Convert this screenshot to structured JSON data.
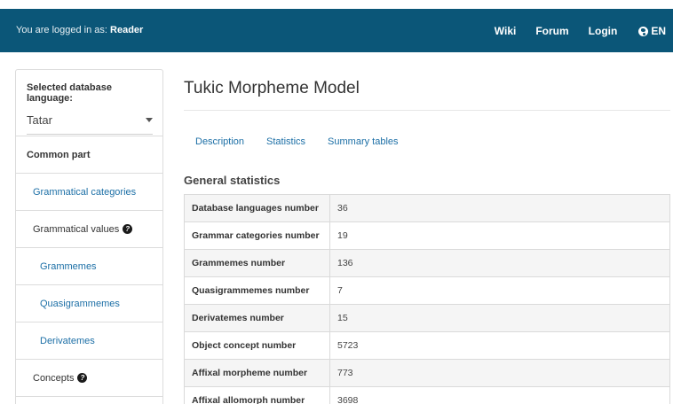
{
  "topbar": {
    "login_prefix": "You are logged in as:",
    "user": "Reader",
    "nav": [
      "Wiki",
      "Forum",
      "Login"
    ],
    "language": "EN",
    "background_color": "#0b5678"
  },
  "sidebar": {
    "selected_language_label": "Selected database language:",
    "selected_language_value": "Tatar",
    "common_part_label": "Common part",
    "items": [
      {
        "label": "Grammatical categories"
      },
      {
        "label": "Grammatical values"
      },
      {
        "label": "Grammemes"
      },
      {
        "label": "Quasigrammemes"
      },
      {
        "label": "Derivatemes"
      },
      {
        "label": "Concepts"
      }
    ]
  },
  "main": {
    "title": "Tukic Morpheme Model",
    "tabs": [
      "Description",
      "Statistics",
      "Summary tables"
    ],
    "section_title": "General statistics",
    "table": [
      {
        "name": "Database languages number",
        "value": "36"
      },
      {
        "name": "Grammar categories number",
        "value": "19"
      },
      {
        "name": "Grammemes number",
        "value": "136"
      },
      {
        "name": "Quasigrammemes number",
        "value": "7"
      },
      {
        "name": "Derivatemes number",
        "value": "15"
      },
      {
        "name": "Object concept number",
        "value": "5723"
      },
      {
        "name": "Affixal morpheme number",
        "value": "773"
      },
      {
        "name": "Affixal allomorph number",
        "value": "3698"
      }
    ]
  }
}
